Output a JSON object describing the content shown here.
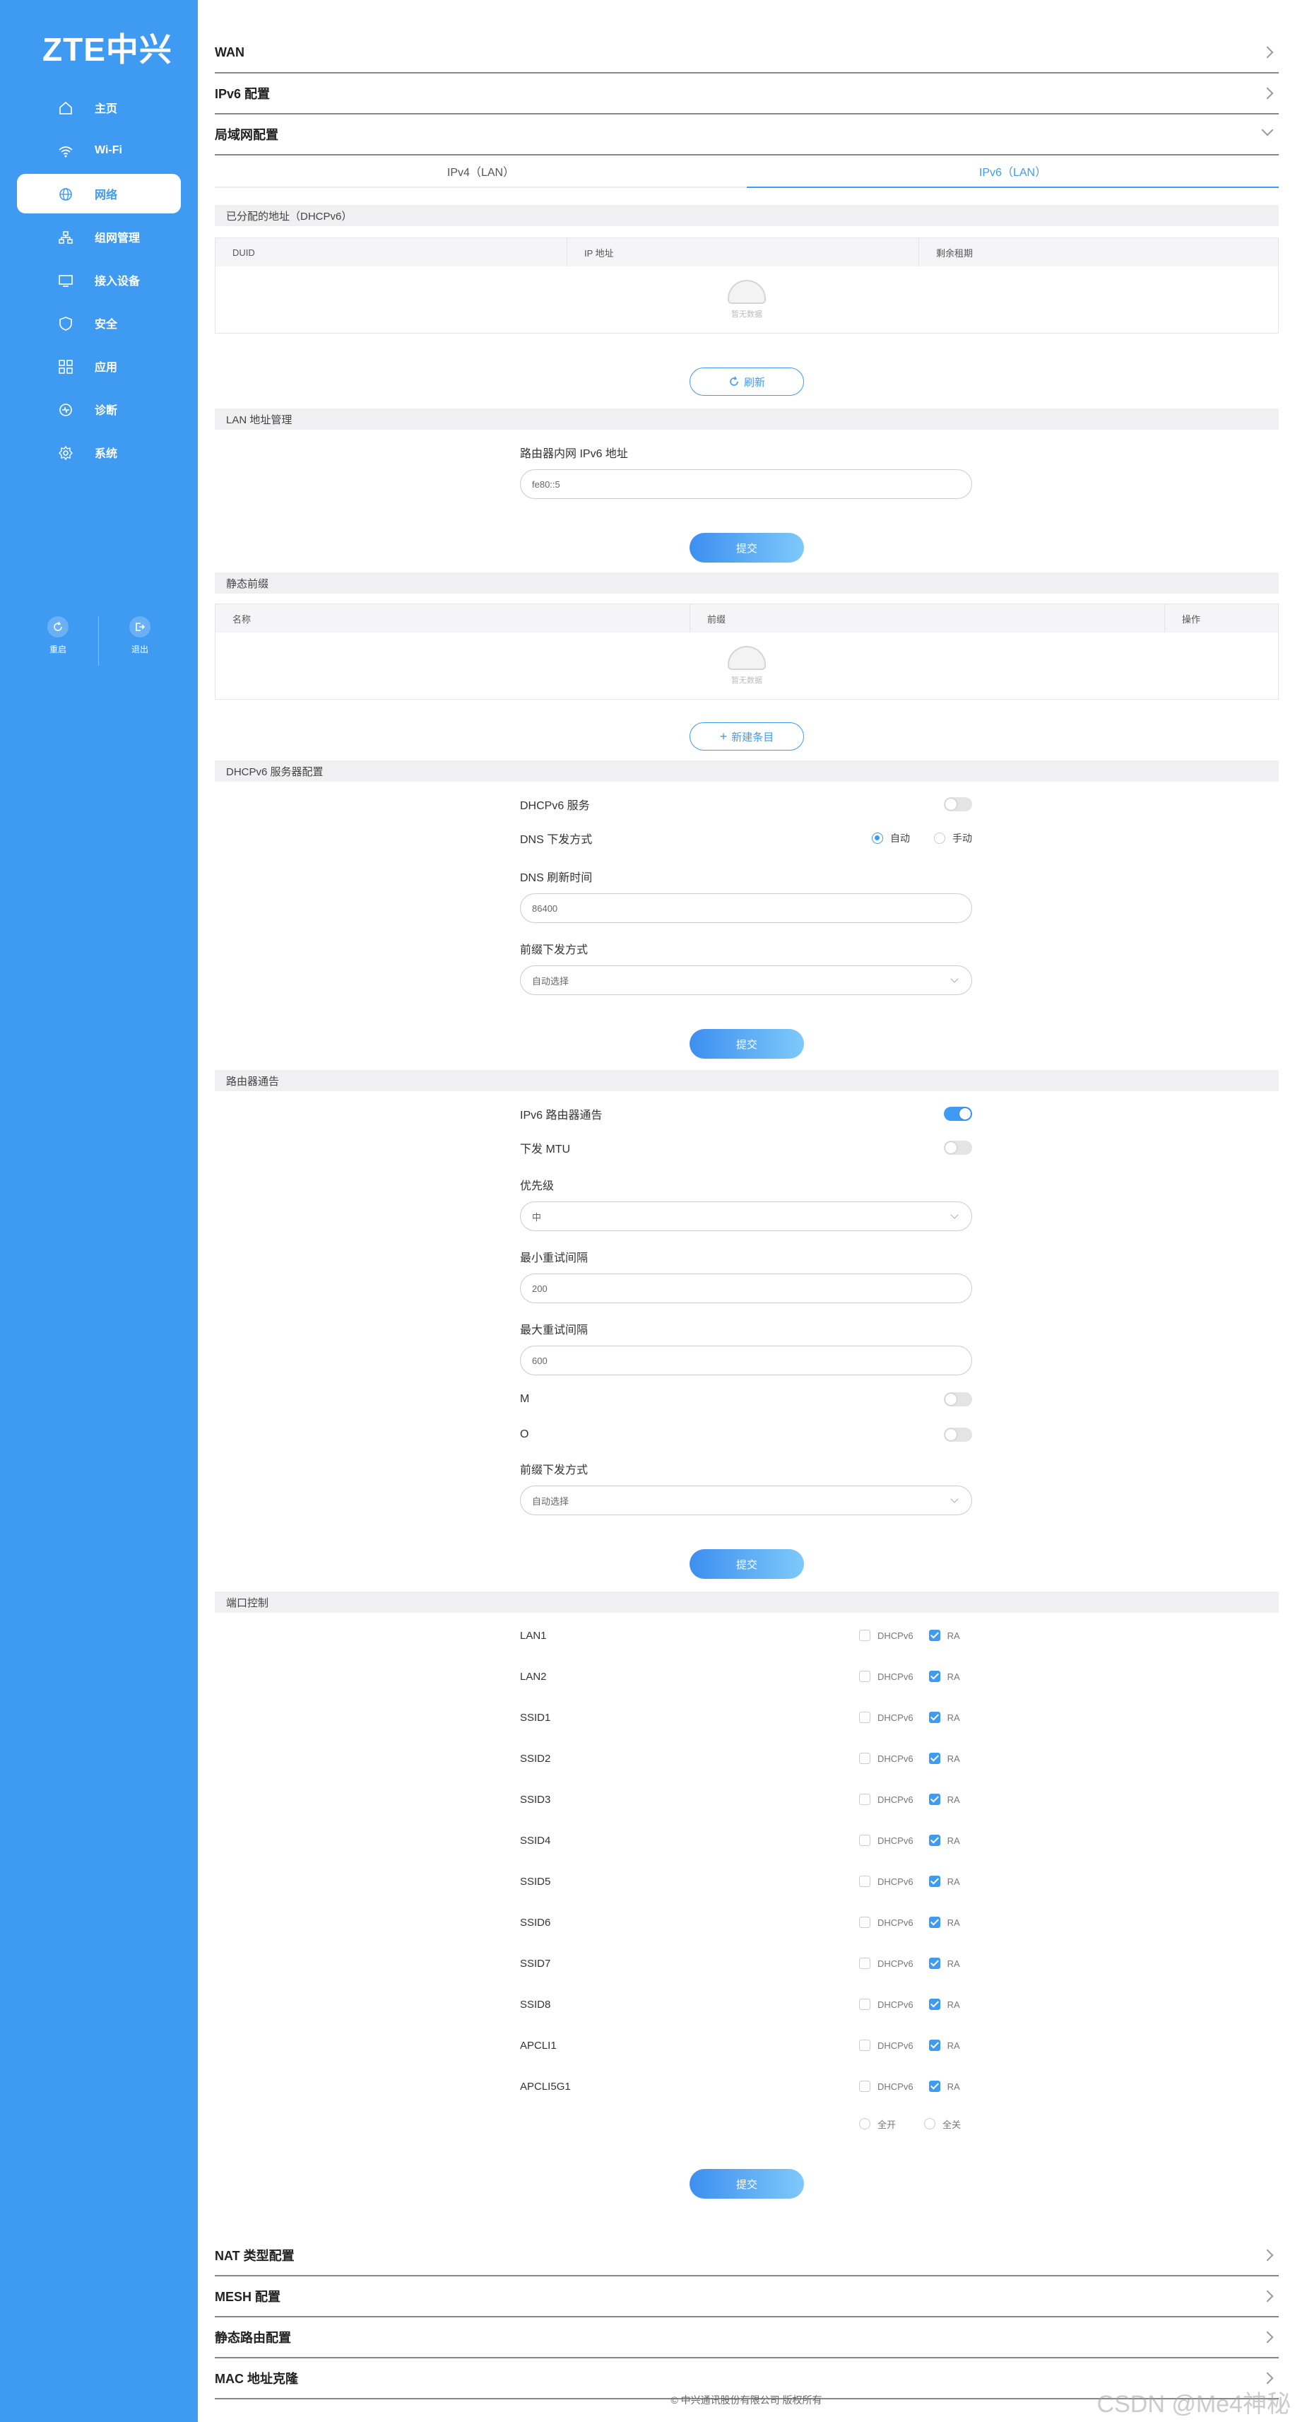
{
  "sidebar": {
    "logo": "ZTE中兴",
    "items": [
      {
        "label": "主页",
        "icon": "home-icon"
      },
      {
        "label": "Wi-Fi",
        "icon": "wifi-icon"
      },
      {
        "label": "网络",
        "icon": "globe-icon",
        "active": true
      },
      {
        "label": "组网管理",
        "icon": "topology-icon"
      },
      {
        "label": "接入设备",
        "icon": "monitor-icon"
      },
      {
        "label": "安全",
        "icon": "shield-icon"
      },
      {
        "label": "应用",
        "icon": "apps-icon"
      },
      {
        "label": "诊断",
        "icon": "diagnose-icon"
      },
      {
        "label": "系统",
        "icon": "settings-icon"
      }
    ],
    "restart_label": "重启",
    "logout_label": "退出"
  },
  "accordion": {
    "wan": "WAN",
    "ipv6": "IPv6 配置",
    "lan": "局域网配置",
    "nat": "NAT 类型配置",
    "mesh": "MESH 配置",
    "static_route": "静态路由配置",
    "mac_clone": "MAC 地址克隆"
  },
  "tabs": {
    "ipv4": "IPv4（LAN）",
    "ipv6": "IPv6（LAN）"
  },
  "assigned": {
    "title": "已分配的地址（DHCPv6）",
    "columns": [
      "DUID",
      "IP 地址",
      "剩余租期"
    ],
    "empty_text": "暂无数据",
    "refresh_label": "刷新"
  },
  "lan_addr": {
    "title": "LAN 地址管理",
    "field_label": "路由器内网 IPv6 地址",
    "field_value": "fe80::5",
    "submit_label": "提交"
  },
  "static_prefix": {
    "title": "静态前缀",
    "columns": [
      "名称",
      "前缀",
      "操作"
    ],
    "empty_text": "暂无数据",
    "add_label": "新建条目"
  },
  "dhcpv6": {
    "title": "DHCPv6 服务器配置",
    "service_label": "DHCPv6 服务",
    "service_on": false,
    "dns_mode_label": "DNS 下发方式",
    "dns_auto": "自动",
    "dns_manual": "手动",
    "dns_refresh_label": "DNS 刷新时间",
    "dns_refresh_value": "86400",
    "prefix_mode_label": "前缀下发方式",
    "prefix_mode_value": "自动选择",
    "submit_label": "提交"
  },
  "ra": {
    "title": "路由器通告",
    "ra_label": "IPv6 路由器通告",
    "ra_on": true,
    "mtu_label": "下发 MTU",
    "mtu_on": false,
    "priority_label": "优先级",
    "priority_value": "中",
    "min_interval_label": "最小重试间隔",
    "min_interval_value": "200",
    "max_interval_label": "最大重试间隔",
    "max_interval_value": "600",
    "m_label": "M",
    "o_label": "O",
    "prefix_mode_label": "前缀下发方式",
    "prefix_mode_value": "自动选择",
    "submit_label": "提交"
  },
  "port_control": {
    "title": "端口控制",
    "dhcpv6_label": "DHCPv6",
    "ra_label": "RA",
    "ports": [
      {
        "name": "LAN1"
      },
      {
        "name": "LAN2"
      },
      {
        "name": "SSID1"
      },
      {
        "name": "SSID2"
      },
      {
        "name": "SSID3"
      },
      {
        "name": "SSID4"
      },
      {
        "name": "SSID5"
      },
      {
        "name": "SSID6"
      },
      {
        "name": "SSID7"
      },
      {
        "name": "SSID8"
      },
      {
        "name": "APCLI1"
      },
      {
        "name": "APCLI5G1"
      }
    ],
    "all_on": "全开",
    "all_off": "全关",
    "submit_label": "提交"
  },
  "footer": "© 中兴通讯股份有限公司 版权所有",
  "watermark": "CSDN @Me4神秘",
  "colors": {
    "accent": "#3f9af2",
    "sidebar": "#3f9af2"
  }
}
